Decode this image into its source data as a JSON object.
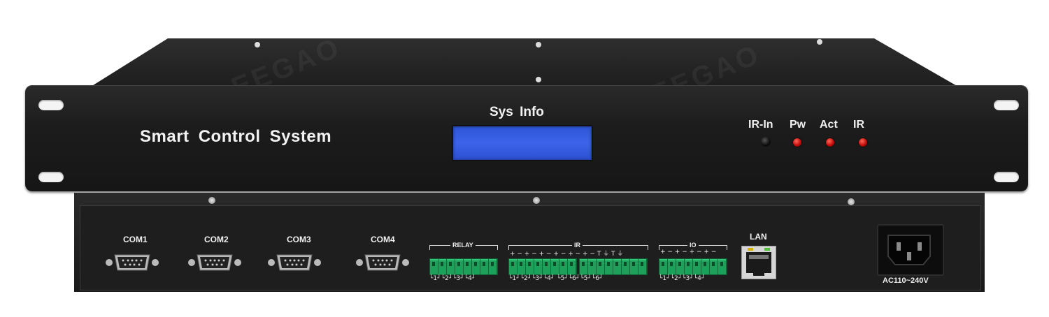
{
  "front_panel": {
    "brand": "Smart Control System",
    "display_label": "Sys Info",
    "indicators": [
      "IR-In",
      "Pw",
      "Act",
      "IR"
    ]
  },
  "rear_panel": {
    "com_ports": [
      "COM1",
      "COM2",
      "COM3",
      "COM4"
    ],
    "relay": {
      "label": "RELAY",
      "pins": "└1┘└2┘└3┘└4┘"
    },
    "ir": {
      "label": "IR",
      "top_pins": "+ − + − + − + − + − + − T ⏚ T ⏚",
      "pins": "└1┘└2┘└3┘└4┘ └5┘└6┘└5┘└6┘"
    },
    "io": {
      "label": "IO",
      "top_pins": "+ − + − + − + −",
      "pins": "└1┘└2┘└3┘└4┘"
    },
    "lan_label": "LAN",
    "power_label": "AC110~240V"
  },
  "watermark": "LEEGAO"
}
